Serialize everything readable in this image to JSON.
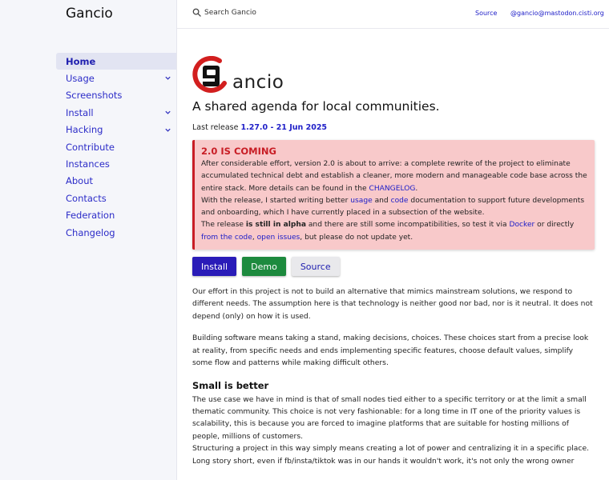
{
  "site": {
    "title": "Gancio"
  },
  "header": {
    "search_label": "Search Gancio",
    "source_link": "Source",
    "mastodon_link": "@gancio@mastodon.cisti.org"
  },
  "sidebar": {
    "items": [
      {
        "label": "Home",
        "active": true,
        "expandable": false
      },
      {
        "label": "Usage",
        "expandable": true
      },
      {
        "label": "Screenshots",
        "expandable": false
      },
      {
        "label": "Install",
        "expandable": true
      },
      {
        "label": "Hacking",
        "expandable": true
      },
      {
        "label": "Contribute",
        "expandable": false
      },
      {
        "label": "Instances",
        "expandable": false
      },
      {
        "label": "About",
        "expandable": false
      },
      {
        "label": "Contacts",
        "expandable": false
      },
      {
        "label": "Federation",
        "expandable": false
      },
      {
        "label": "Changelog",
        "expandable": false
      }
    ]
  },
  "main": {
    "logo_text": "ancio",
    "tagline": "A shared agenda for local communities.",
    "release_prefix": "Last release ",
    "release_link": "1.27.0 - 21 Jun 2025",
    "alert": {
      "title": "2.0 IS COMING",
      "p1": "After considerable effort, version 2.0 is about to arrive: a complete rewrite of the project to eliminate accumulated technical debt and establish a cleaner, more modern and manageable code base across the entire stack. More details can be found in the ",
      "changelog_link": "CHANGELOG",
      "p1_end": ".",
      "p2_a": "With the release, I started writing better ",
      "usage_link": "usage",
      "p2_b": " and ",
      "code_link": "code",
      "p2_c": " documentation to support future developments and onboarding, which I have currently placed in a subsection of the website.",
      "p3_a": "The release ",
      "p3_bold": "is still in alpha",
      "p3_b": " and there are still some incompatibilities, so test it via ",
      "docker_link": "Docker",
      "p3_c": " or directly ",
      "from_code_link": "from the code",
      "p3_d": ", ",
      "issues_link": "open issues",
      "p3_e": ", but please do not update yet."
    },
    "buttons": {
      "install": "Install",
      "demo": "Demo",
      "source": "Source"
    },
    "para1": "Our effort in this project is not to build an alternative that mimics mainstream solutions, we respond to different needs. The assumption here is that technology is neither good nor bad, nor is it neutral. It does not depend (only) on how it is used.",
    "para2": "Building software means taking a stand, making decisions, choices. These choices start from a precise look at reality, from specific needs and ends implementing specific features, choose default values, simplify some flow and patterns while making difficult others.",
    "section_title": "Small is better",
    "para3": "The use case we have in mind is that of small nodes tied either to a specific territory or at the limit a small thematic community. This choice is not very fashionable: for a long time in IT one of the priority values is scalability, this is because you are forced to imagine platforms that are suitable for hosting millions of people, millions of customers.",
    "para4": "Structuring a project in this way simply means creating a lot of power and centralizing it in a specific place.",
    "para5": "Long story short, even if fb/insta/tiktok was in our hands it wouldn't work, it's not only the wrong owner"
  },
  "colors": {
    "accent": "#2020c8",
    "alert_bg": "#f8c9ca",
    "alert_border": "#c81d25",
    "install": "#2a1cb8",
    "demo": "#1d8a3e"
  }
}
